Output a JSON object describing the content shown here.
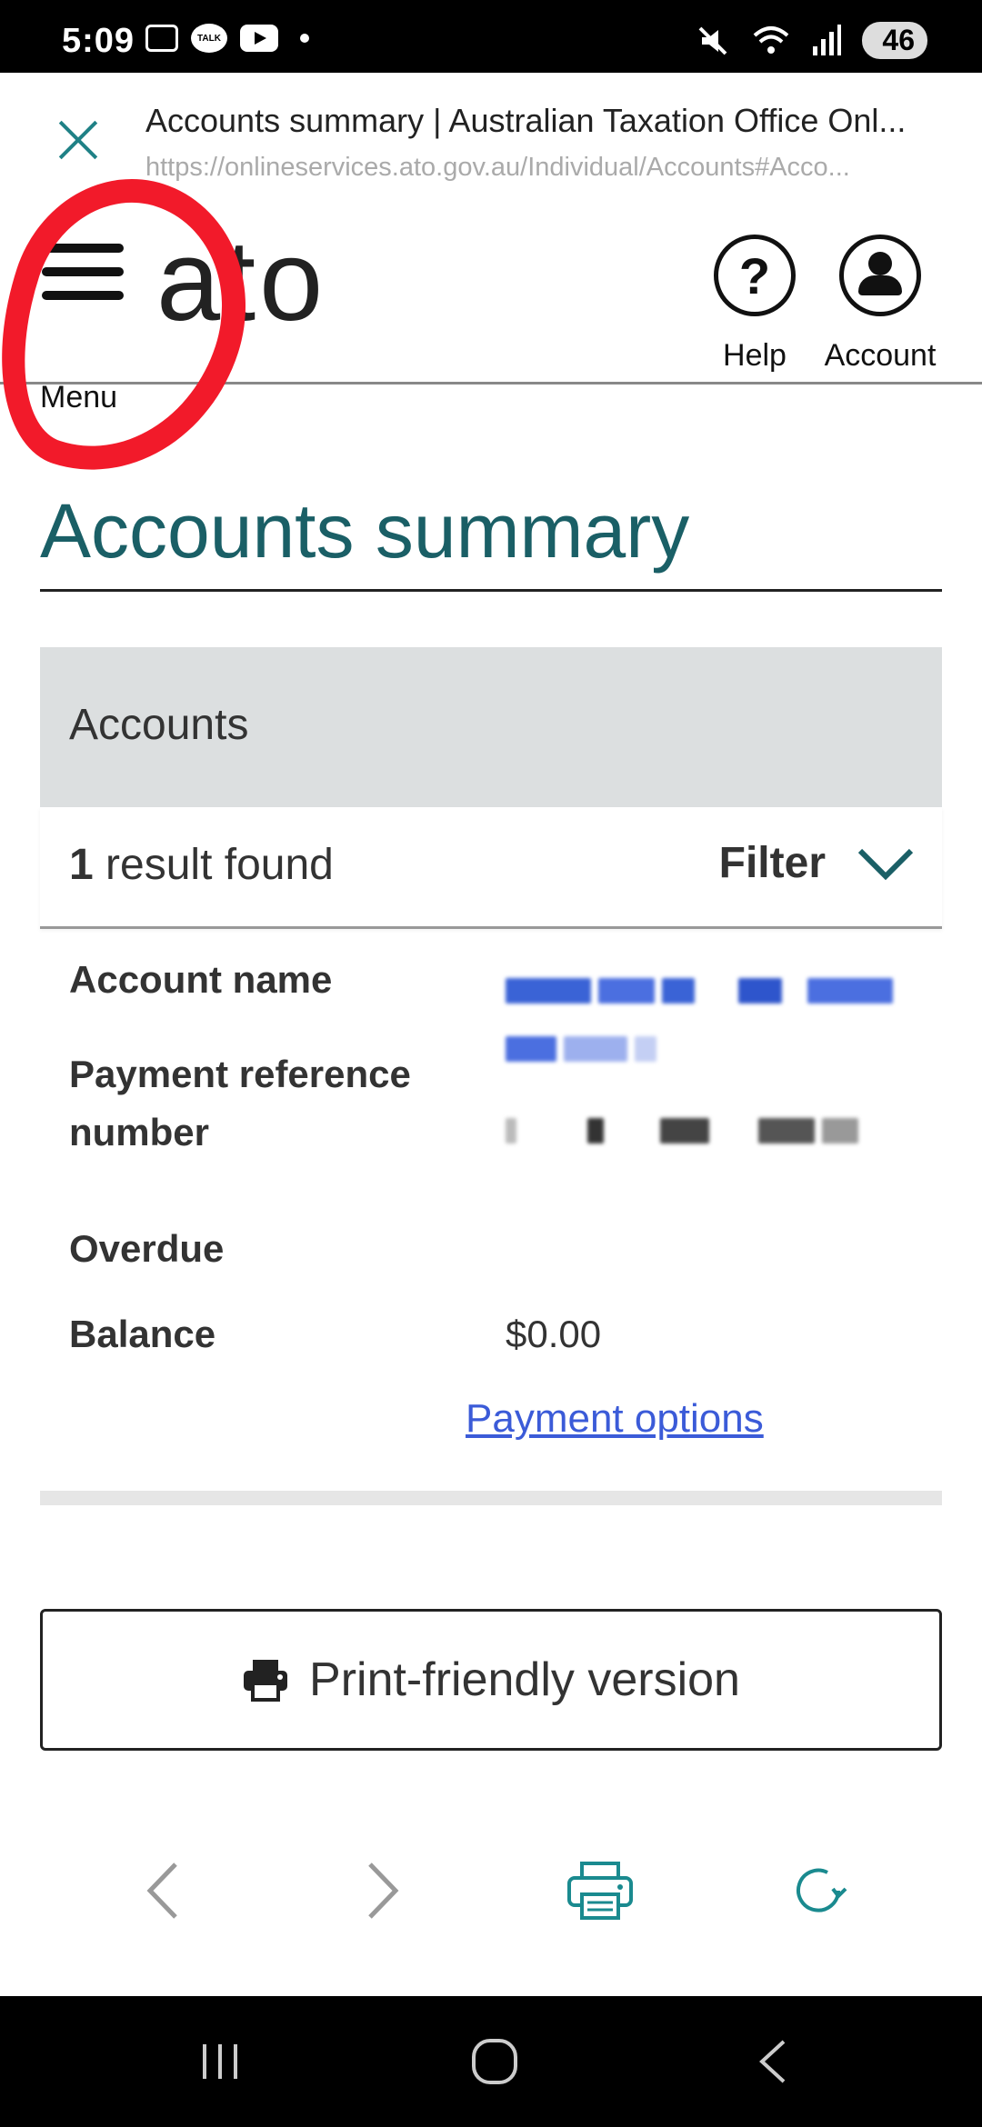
{
  "status_bar": {
    "time": "5:09",
    "talk_icon": "TALK",
    "battery": "46"
  },
  "browser": {
    "page_title": "Accounts summary | Australian Taxation Office Onl...",
    "url": "https://onlineservices.ato.gov.au/Individual/Accounts#Acco..."
  },
  "header": {
    "menu_label": "Menu",
    "logo": "ato",
    "help_label": "Help",
    "help_glyph": "?",
    "account_label": "Account"
  },
  "main": {
    "title": "Accounts summary",
    "panel_heading": "Accounts",
    "results_count": "1",
    "results_text": " result found",
    "filter_label": "Filter",
    "details": {
      "account_name_label": "Account name",
      "payment_reference_label": "Payment reference number",
      "overdue_label": "Overdue",
      "balance_label": "Balance",
      "balance_value": "$0.00",
      "payment_options_link": "Payment options"
    },
    "print_button": "Print-friendly version"
  },
  "colors": {
    "brand_teal": "#1a5f66",
    "link_blue": "#3b5bd8",
    "annotation_red": "#f21a2a",
    "panel_grey": "#dcdfe0"
  },
  "icons": [
    "close-icon",
    "hamburger-menu-icon",
    "help-icon",
    "account-icon",
    "chevron-down-icon",
    "printer-icon",
    "back-arrow-icon",
    "forward-arrow-icon",
    "refresh-icon"
  ]
}
